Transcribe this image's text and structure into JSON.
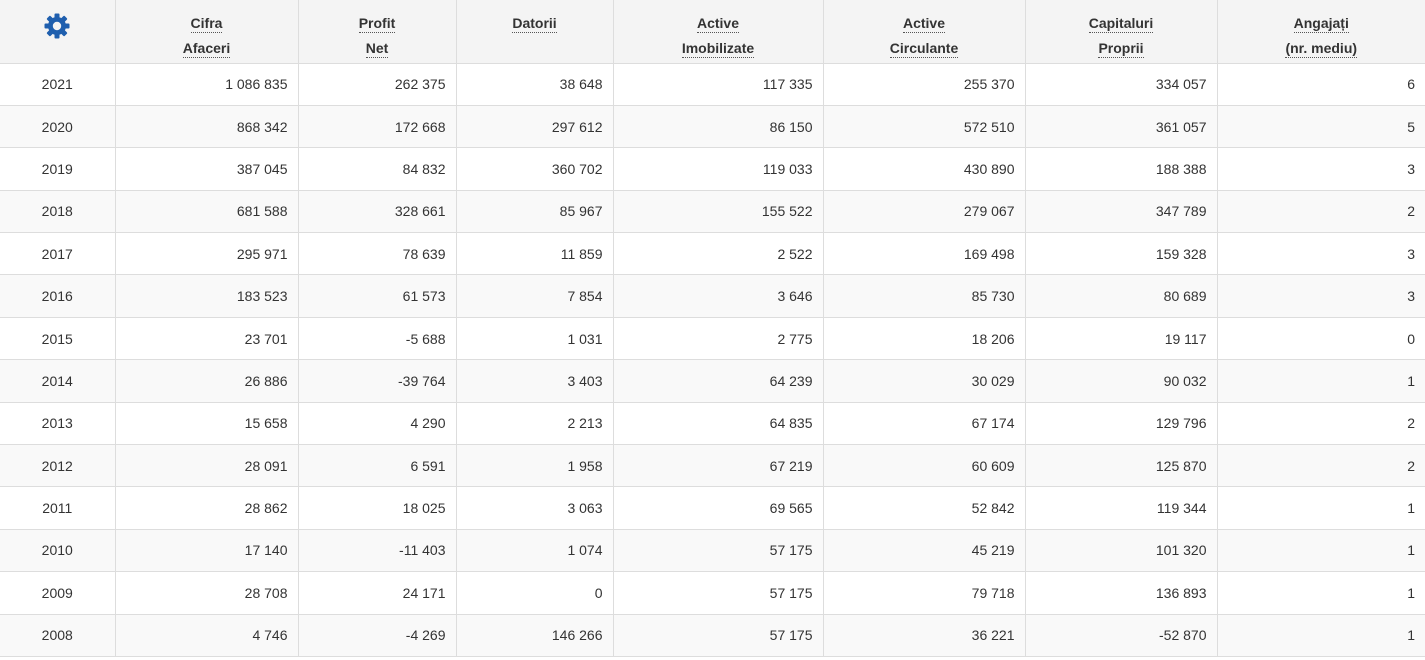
{
  "colors": {
    "gear": "#1f5fae",
    "header_bg": "#f4f4f4",
    "border": "#dddddd",
    "row_alt_bg": "#f9f9f9"
  },
  "header": {
    "settings_icon": "gear-icon",
    "columns": [
      {
        "line1": "Cifra",
        "line2": "Afaceri"
      },
      {
        "line1": "Profit",
        "line2": "Net"
      },
      {
        "line1": "Datorii",
        "line2": ""
      },
      {
        "line1": "Active",
        "line2": "Imobilizate"
      },
      {
        "line1": "Active",
        "line2": "Circulante"
      },
      {
        "line1": "Capitaluri",
        "line2": "Proprii"
      },
      {
        "line1": "Angajați",
        "line2": "(nr. mediu)"
      }
    ]
  },
  "rows": [
    {
      "year": "2021",
      "cifra": "1 086 835",
      "profit": "262 375",
      "datorii": "38 648",
      "imob": "117 335",
      "circ": "255 370",
      "capital": "334 057",
      "angajati": "6"
    },
    {
      "year": "2020",
      "cifra": "868 342",
      "profit": "172 668",
      "datorii": "297 612",
      "imob": "86 150",
      "circ": "572 510",
      "capital": "361 057",
      "angajati": "5"
    },
    {
      "year": "2019",
      "cifra": "387 045",
      "profit": "84 832",
      "datorii": "360 702",
      "imob": "119 033",
      "circ": "430 890",
      "capital": "188 388",
      "angajati": "3"
    },
    {
      "year": "2018",
      "cifra": "681 588",
      "profit": "328 661",
      "datorii": "85 967",
      "imob": "155 522",
      "circ": "279 067",
      "capital": "347 789",
      "angajati": "2"
    },
    {
      "year": "2017",
      "cifra": "295 971",
      "profit": "78 639",
      "datorii": "11 859",
      "imob": "2 522",
      "circ": "169 498",
      "capital": "159 328",
      "angajati": "3"
    },
    {
      "year": "2016",
      "cifra": "183 523",
      "profit": "61 573",
      "datorii": "7 854",
      "imob": "3 646",
      "circ": "85 730",
      "capital": "80 689",
      "angajati": "3"
    },
    {
      "year": "2015",
      "cifra": "23 701",
      "profit": "-5 688",
      "datorii": "1 031",
      "imob": "2 775",
      "circ": "18 206",
      "capital": "19 117",
      "angajati": "0"
    },
    {
      "year": "2014",
      "cifra": "26 886",
      "profit": "-39 764",
      "datorii": "3 403",
      "imob": "64 239",
      "circ": "30 029",
      "capital": "90 032",
      "angajati": "1"
    },
    {
      "year": "2013",
      "cifra": "15 658",
      "profit": "4 290",
      "datorii": "2 213",
      "imob": "64 835",
      "circ": "67 174",
      "capital": "129 796",
      "angajati": "2"
    },
    {
      "year": "2012",
      "cifra": "28 091",
      "profit": "6 591",
      "datorii": "1 958",
      "imob": "67 219",
      "circ": "60 609",
      "capital": "125 870",
      "angajati": "2"
    },
    {
      "year": "2011",
      "cifra": "28 862",
      "profit": "18 025",
      "datorii": "3 063",
      "imob": "69 565",
      "circ": "52 842",
      "capital": "119 344",
      "angajati": "1"
    },
    {
      "year": "2010",
      "cifra": "17 140",
      "profit": "-11 403",
      "datorii": "1 074",
      "imob": "57 175",
      "circ": "45 219",
      "capital": "101 320",
      "angajati": "1"
    },
    {
      "year": "2009",
      "cifra": "28 708",
      "profit": "24 171",
      "datorii": "0",
      "imob": "57 175",
      "circ": "79 718",
      "capital": "136 893",
      "angajati": "1"
    },
    {
      "year": "2008",
      "cifra": "4 746",
      "profit": "-4 269",
      "datorii": "146 266",
      "imob": "57 175",
      "circ": "36 221",
      "capital": "-52 870",
      "angajati": "1"
    }
  ]
}
